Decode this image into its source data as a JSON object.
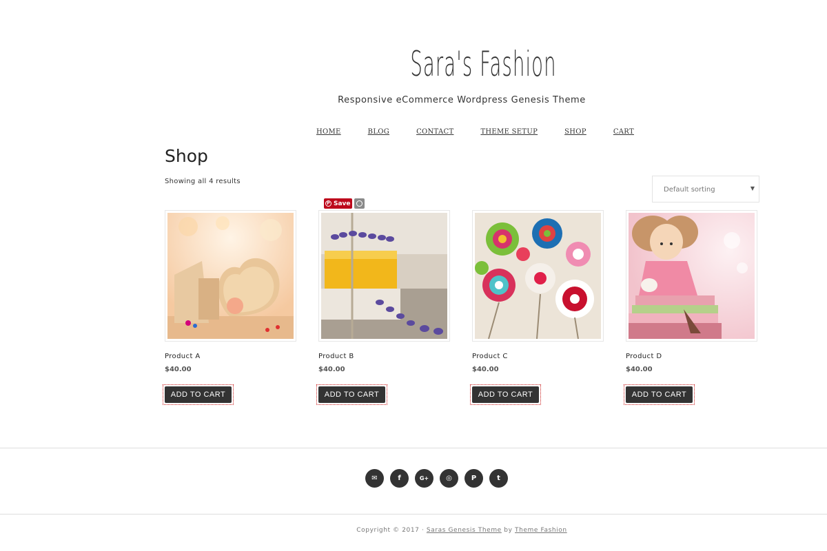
{
  "header": {
    "site_title": "Sara's Fashion",
    "tagline": "Responsive eCommerce Wordpress Genesis Theme"
  },
  "nav": {
    "items": [
      {
        "label": "HOME"
      },
      {
        "label": "BLOG"
      },
      {
        "label": "CONTACT"
      },
      {
        "label": "THEME SETUP"
      },
      {
        "label": "SHOP"
      },
      {
        "label": "CART"
      }
    ]
  },
  "shop": {
    "title": "Shop",
    "result_count": "Showing all 4 results",
    "sorting": {
      "selected": "Default sorting"
    },
    "pinterest": {
      "save_label": "Save"
    },
    "products": [
      {
        "name": "Product A",
        "price": "$40.00",
        "button": "ADD TO CART"
      },
      {
        "name": "Product B",
        "price": "$40.00",
        "button": "ADD TO CART"
      },
      {
        "name": "Product C",
        "price": "$40.00",
        "button": "ADD TO CART"
      },
      {
        "name": "Product D",
        "price": "$40.00",
        "button": "ADD TO CART"
      }
    ]
  },
  "social": {
    "icons": [
      "envelope-icon",
      "facebook-icon",
      "google-plus-icon",
      "instagram-icon",
      "pinterest-icon",
      "twitter-icon"
    ]
  },
  "footer": {
    "prefix": "Copyright © 2017 ·",
    "theme_link": "Saras Genesis Theme",
    "by": "by",
    "author_link": "Theme Fashion"
  },
  "colors": {
    "button_bg": "#333333",
    "pinterest_red": "#bd081c",
    "footer_text": "#777777"
  }
}
